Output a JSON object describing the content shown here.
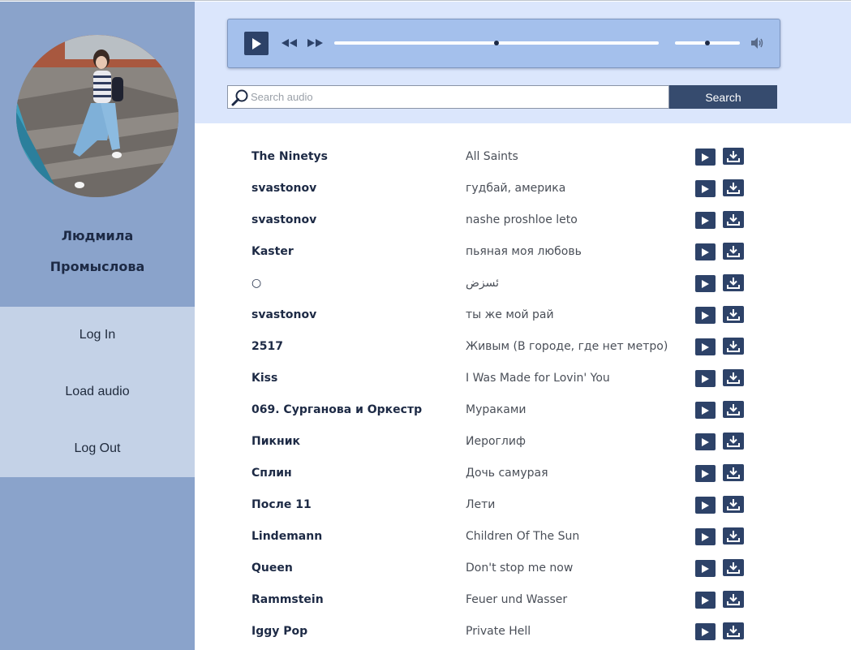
{
  "user": {
    "first_name": "Людмила",
    "last_name": "Промыслова"
  },
  "menu": {
    "items": [
      {
        "label": "Log In"
      },
      {
        "label": "Load audio"
      },
      {
        "label": "Log Out"
      }
    ]
  },
  "player": {
    "progress": 0.5,
    "volume": 0.5
  },
  "search": {
    "placeholder": "Search audio",
    "value": "",
    "button_label": "Search"
  },
  "colors": {
    "sidebar": "#8aa3cb",
    "menu": "#c4d2e7",
    "topbar": "#dbe6fc",
    "player": "#a4c0ec",
    "accent": "#2d4268"
  },
  "icons": {
    "play": "play-icon",
    "rewind": "rewind-icon",
    "forward": "fast-forward-icon",
    "volume": "volume-icon",
    "search": "magnifier-icon",
    "download": "download-icon"
  },
  "tracks": [
    {
      "artist": "The Ninetys",
      "title": "All Saints"
    },
    {
      "artist": "svastonov",
      "title": "гудбай, америка"
    },
    {
      "artist": "svastonov",
      "title": "nashe proshloe leto"
    },
    {
      "artist": "Kaster",
      "title": "пьяная моя любовь"
    },
    {
      "artist": "○",
      "title": "ئسزض"
    },
    {
      "artist": "svastonov",
      "title": "ты же мой рай"
    },
    {
      "artist": "2517",
      "title": "Живым (В городе, где нет метро)"
    },
    {
      "artist": "Kiss",
      "title": "I Was Made for Lovin' You"
    },
    {
      "artist": "069. Сурганова и Оркестр",
      "title": "Мураками"
    },
    {
      "artist": "Пикник",
      "title": "Иероглиф"
    },
    {
      "artist": "Сплин",
      "title": "Дочь самурая"
    },
    {
      "artist": "После 11",
      "title": "Лети"
    },
    {
      "artist": "Lindemann",
      "title": "Children Of The Sun"
    },
    {
      "artist": "Queen",
      "title": "Don't stop me now"
    },
    {
      "artist": "Rammstein",
      "title": "Feuer und Wasser"
    },
    {
      "artist": "Iggy Pop",
      "title": "Private Hell"
    }
  ]
}
